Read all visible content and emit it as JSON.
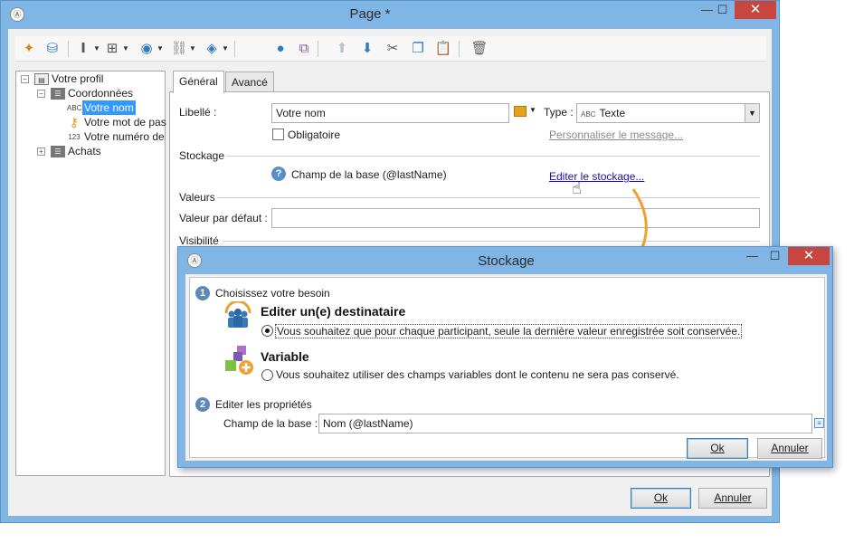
{
  "main_window": {
    "title": "Page *",
    "app_icon": "adobe-campaign-icon",
    "controls": {
      "minimize": "—",
      "maximize": "☐",
      "close": "✕"
    }
  },
  "toolbar": {
    "icons": [
      "magic-wand-icon",
      "database-link-icon",
      "text-cursor-icon",
      "add-element-icon",
      "globe-icon",
      "link-icon",
      "layers-icon",
      "user-icon",
      "structure-icon",
      "move-up-icon",
      "move-down-icon",
      "cut-icon",
      "copy-icon",
      "paste-icon",
      "delete-icon"
    ]
  },
  "tree": {
    "root": "Votre profil",
    "group1": "Coordonnées",
    "item1_badge": "ABC",
    "item1": "Votre nom",
    "item2": "Votre mot de pas",
    "item3_badge": "123",
    "item3": "Votre numéro de",
    "group2": "Achats"
  },
  "tabs": {
    "general": "Général",
    "advanced": "Avancé"
  },
  "form": {
    "label_caption": "Libellé :",
    "label_value": "Votre nom",
    "type_caption": "Type :",
    "type_badge": "ABC",
    "type_value": "Texte",
    "mandatory_label": "Obligatoire",
    "custom_message_link": "Personnaliser le message...",
    "storage_section": "Stockage",
    "storage_help_text": "Champ de la base (@lastName)",
    "edit_storage_link": "Editer le stockage...",
    "values_section": "Valeurs",
    "default_value_caption": "Valeur par défaut :",
    "default_value": "",
    "visibility_section": "Visibilité"
  },
  "main_buttons": {
    "ok": "Ok",
    "cancel": "Annuler"
  },
  "dialog": {
    "title": "Stockage",
    "step1_number": "1",
    "step1_title": "Choisissez votre besoin",
    "option1_title": "Editer un(e) destinataire",
    "option1_desc": "Vous souhaitez que pour chaque participant, seule la dernière valeur enregistrée soit conservée.",
    "option1_selected": true,
    "option2_title": "Variable",
    "option2_desc": "Vous souhaitez utiliser des champs variables dont le contenu ne sera pas conservé.",
    "option2_selected": false,
    "step2_number": "2",
    "step2_title": "Editer les propriétés",
    "db_field_caption": "Champ de la base :",
    "db_field_value": "Nom (@lastName)",
    "ok": "Ok",
    "cancel": "Annuler"
  },
  "colors": {
    "window_frame": "#7fb6e6",
    "close_button": "#c7463d",
    "selection": "#3399ff",
    "arrow": "#f0a030",
    "link": "#1a0dab"
  }
}
